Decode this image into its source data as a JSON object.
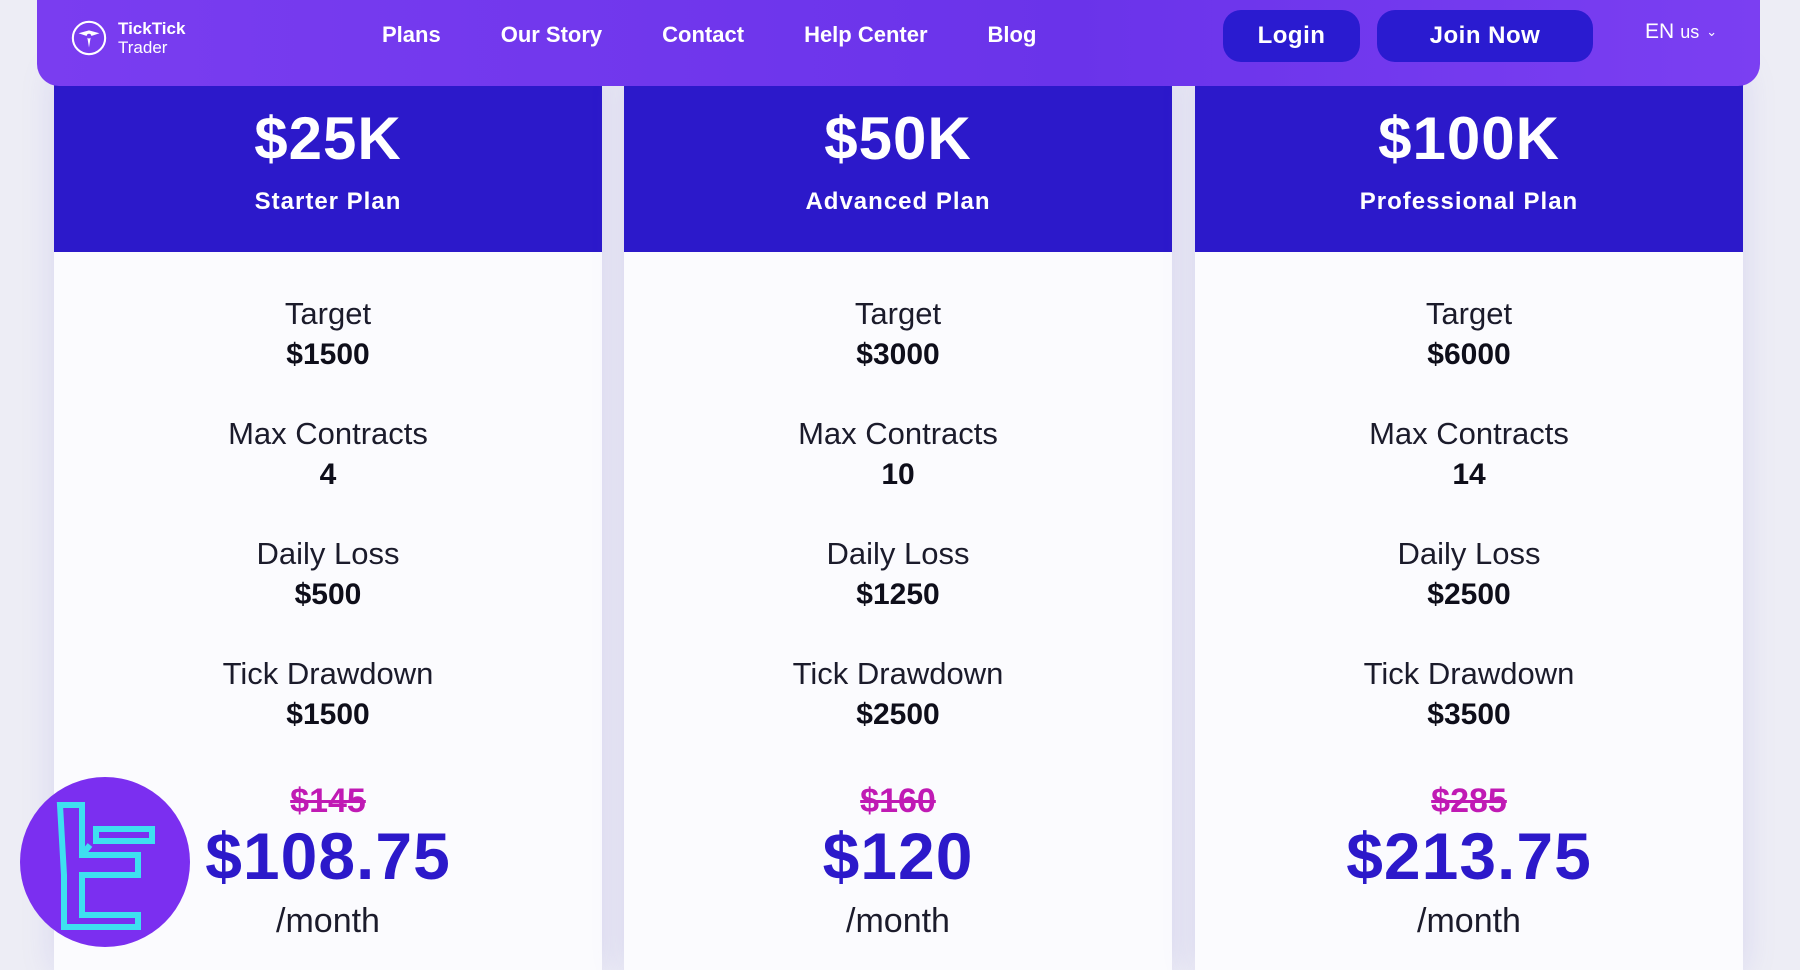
{
  "nav": {
    "brand_line1": "TickTick",
    "brand_line2": "Trader",
    "links": [
      "Plans",
      "Our Story",
      "Contact",
      "Help Center",
      "Blog"
    ],
    "login_label": "Login",
    "join_label": "Join Now",
    "lang_code": "EN",
    "lang_region": "us"
  },
  "colors": {
    "nav_bg": "#7a3df0",
    "button_bg": "#2a1bd0",
    "card_header_bg": "#2c19ca",
    "price_color": "#2c19ca",
    "old_price_color": "#c01ab4",
    "watermark_bg": "#7b2ff0",
    "watermark_fg": "#3ee0f0"
  },
  "icons": {
    "brand": "ticktick-logo-icon",
    "lang": "chevron-down-icon",
    "watermark": "watermark-logo"
  },
  "plans": [
    {
      "amount": "$25K",
      "name": "Starter Plan",
      "target_label": "Target",
      "target": "$1500",
      "contracts_label": "Max Contracts",
      "contracts": "4",
      "loss_label": "Daily Loss",
      "loss": "$500",
      "drawdown_label": "Tick Drawdown",
      "drawdown": "$1500",
      "old_price": "$145",
      "price": "$108.75",
      "period": "/month"
    },
    {
      "amount": "$50K",
      "name": "Advanced Plan",
      "target_label": "Target",
      "target": "$3000",
      "contracts_label": "Max Contracts",
      "contracts": "10",
      "loss_label": "Daily Loss",
      "loss": "$1250",
      "drawdown_label": "Tick Drawdown",
      "drawdown": "$2500",
      "old_price": "$160",
      "price": "$120",
      "period": "/month"
    },
    {
      "amount": "$100K",
      "name": "Professional Plan",
      "target_label": "Target",
      "target": "$6000",
      "contracts_label": "Max Contracts",
      "contracts": "14",
      "loss_label": "Daily Loss",
      "loss": "$2500",
      "drawdown_label": "Tick Drawdown",
      "drawdown": "$3500",
      "old_price": "$285",
      "price": "$213.75",
      "period": "/month"
    }
  ]
}
